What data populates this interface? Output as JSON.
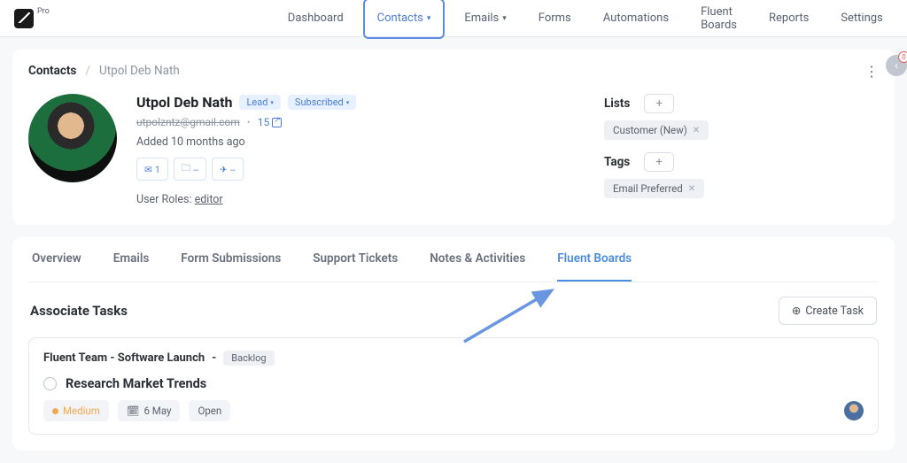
{
  "header": {
    "logo_label": "Pro"
  },
  "nav": {
    "dashboard": "Dashboard",
    "contacts": "Contacts",
    "emails": "Emails",
    "forms": "Forms",
    "automations": "Automations",
    "fluent_boards": "Fluent Boards",
    "reports": "Reports",
    "settings": "Settings"
  },
  "breadcrumb": {
    "root": "Contacts",
    "sep": "/",
    "leaf": "Utpol Deb Nath"
  },
  "contact": {
    "name": "Utpol Deb Nath",
    "status_badge": "Lead",
    "subscribe_badge": "Subscribed",
    "email": "utpolzntz@gmail.com",
    "link_num": "15",
    "added": "Added 10 months ago",
    "activity": {
      "emails": "1",
      "folders": "--",
      "sends": "--"
    },
    "roles_label": "User Roles:",
    "role": "editor"
  },
  "meta": {
    "lists_label": "Lists",
    "list_chip": "Customer (New)",
    "tags_label": "Tags",
    "tag_chip": "Email Preferred"
  },
  "tabs": {
    "overview": "Overview",
    "emails": "Emails",
    "forms": "Form Submissions",
    "tickets": "Support Tickets",
    "notes": "Notes & Activities",
    "boards": "Fluent Boards"
  },
  "tasks": {
    "section_title": "Associate Tasks",
    "create_btn": "Create Task",
    "board_name": "Fluent Team - Software Launch",
    "board_sep": "-",
    "stage": "Backlog",
    "task_title": "Research Market Trends",
    "priority": "Medium",
    "due": "6 May",
    "status": "Open"
  },
  "side_bubble_count": "0"
}
